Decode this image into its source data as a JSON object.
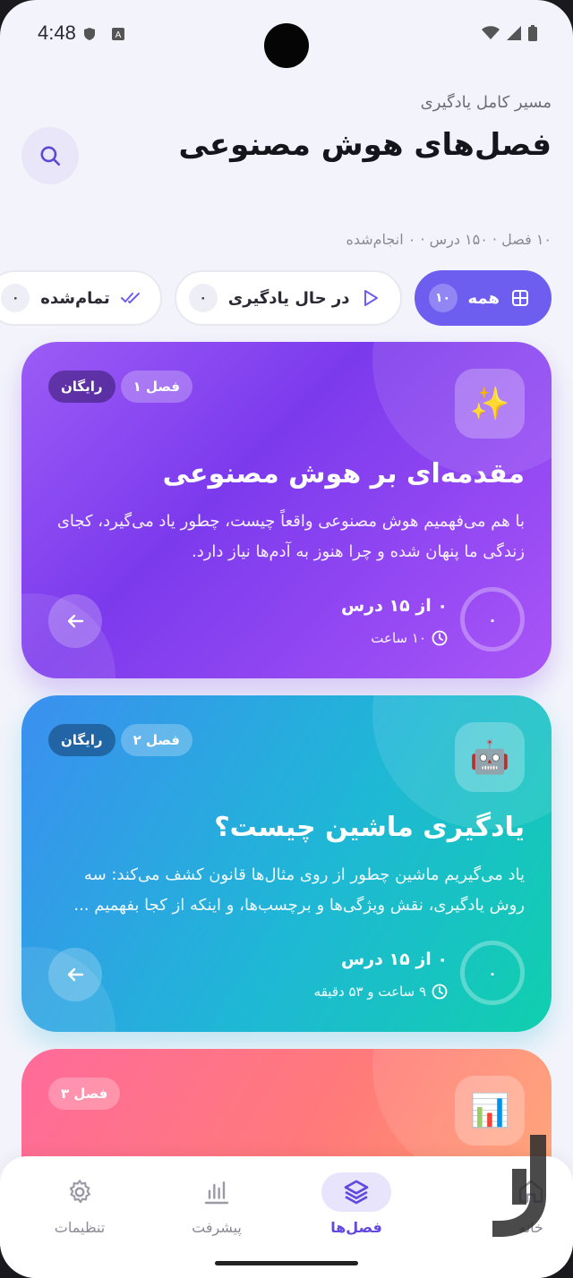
{
  "status_bar": {
    "time": "4:48"
  },
  "header": {
    "subtitle": "مسیر کامل یادگیری",
    "title": "فصل‌های هوش مصنوعی",
    "stats": "۱۰ فصل · ۱۵۰ درس · ۰ انجام‌شده"
  },
  "filters": [
    {
      "label": "همه",
      "count": "۱۰",
      "icon": "grid-icon",
      "active": true
    },
    {
      "label": "در حال یادگیری",
      "count": "۰",
      "icon": "play-icon",
      "active": false
    },
    {
      "label": "تمام‌شده",
      "count": "۰",
      "icon": "double-check-icon",
      "active": false
    }
  ],
  "cards": [
    {
      "emoji": "✨",
      "chapter": "فصل ۱",
      "free_label": "رایگان",
      "title": "مقدمه‌ای بر هوش مصنوعی",
      "description": "با هم می‌فهمیم هوش مصنوعی واقعاً چیست، چطور یاد می‌گیرد، کجای زندگی ما پنهان شده و چرا هنوز به آدم‌ها نیاز دارد.",
      "lessons": "۰ از ۱۵ درس",
      "duration": "۱۰ ساعت",
      "progress": "۰"
    },
    {
      "emoji": "🤖",
      "chapter": "فصل ۲",
      "free_label": "رایگان",
      "title": "یادگیری ماشین چیست؟",
      "description": "یاد می‌گیریم ماشین چطور از روی مثال‌ها قانون کشف می‌کند: سه روش یادگیری، نقش ویژگی‌ها و برچسب‌ها، و اینکه از کجا بفهمیم ...",
      "lessons": "۰ از ۱۵ درس",
      "duration": "۹ ساعت و ۵۳ دقیقه",
      "progress": "۰"
    },
    {
      "emoji": "📊",
      "chapter": "فصل ۳"
    }
  ],
  "bottom_nav": [
    {
      "label": "خانه",
      "icon": "home-icon"
    },
    {
      "label": "فصل‌ها",
      "icon": "layers-icon",
      "active": true
    },
    {
      "label": "پیشرفت",
      "icon": "bar-chart-icon"
    },
    {
      "label": "تنظیمات",
      "icon": "gear-icon"
    }
  ],
  "colors": {
    "accent": "#6e5ef0",
    "card1": "#8b45f0",
    "card2": "#1fb7d6",
    "card3": "#ff7a7a",
    "background": "#f3f4fb"
  }
}
